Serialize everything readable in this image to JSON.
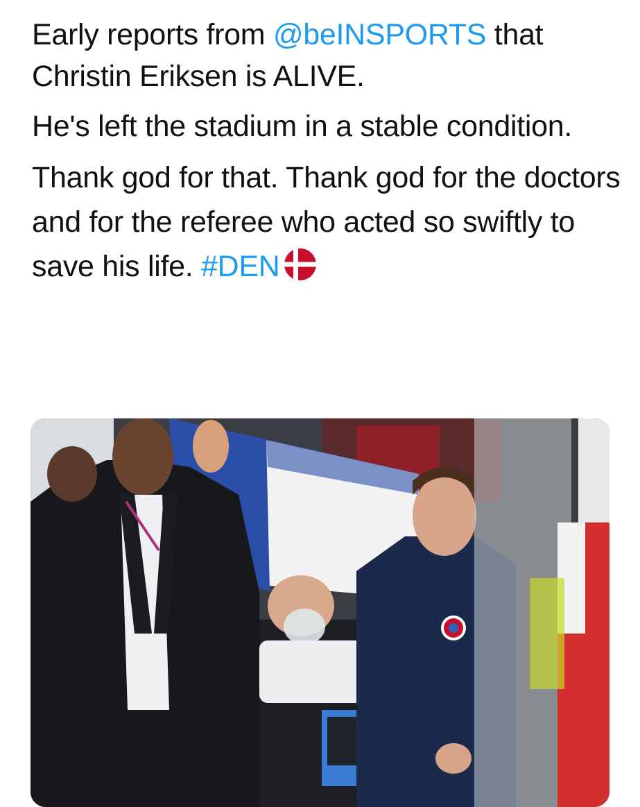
{
  "tweet": {
    "paragraph1": {
      "before_mention": "Early reports from ",
      "mention": "@beINSPORTS",
      "after_mention": " that Christin Eriksen is ALIVE."
    },
    "paragraph2": "He's left the stadium in a stable condition.",
    "paragraph3": {
      "text": "Thank god for that. Thank god for the doctors and for the referee who acted so swiftly to save his life. ",
      "hashtag": "#DEN",
      "flag_emoji": "denmark-flag-icon"
    }
  },
  "colors": {
    "link": "#1d9bf0",
    "text": "#111111",
    "danish_red": "#c8102e"
  },
  "media": {
    "type": "photo",
    "icon": "photo-icon"
  }
}
